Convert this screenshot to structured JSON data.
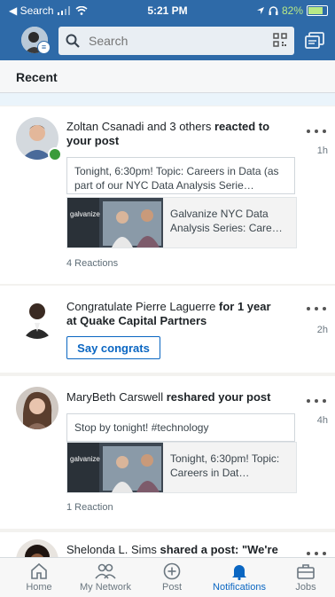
{
  "status_bar": {
    "back_label": "◀ Search",
    "time": "5:21 PM",
    "battery": "82%",
    "battery_level": 0.82
  },
  "header": {
    "search_placeholder": "Search"
  },
  "tabs": {
    "recent": "Recent"
  },
  "notifications": [
    {
      "name": "Zoltan Csanadi and 3 others",
      "action": " reacted to your post",
      "time": "1h",
      "quote": "Tonight, 6:30pm!  Topic: Careers in Data (as part of our NYC Data Analysis Serie…",
      "shared_title": "Galvanize NYC Data Analysis Series: Care…",
      "thumb_brand": "galvanize",
      "reactions": "4 Reactions"
    },
    {
      "name": "Congratulate Pierre Laguerre",
      "action": " for 1 year at Quake Capital Partners",
      "time": "2h",
      "button": "Say congrats"
    },
    {
      "name": "MaryBeth Carswell",
      "action": " reshared your post",
      "time": "4h",
      "quote": "Stop by tonight! #technology",
      "shared_title": "Tonight, 6:30pm! Topic: Careers in Dat…",
      "thumb_brand": "galvanize",
      "reactions": "1 Reaction"
    },
    {
      "name": "Shelonda L. Sims",
      "action": " shared a post: \"We're"
    }
  ],
  "bottom_nav": {
    "home": "Home",
    "network": "My Network",
    "post": "Post",
    "notifications": "Notifications",
    "jobs": "Jobs"
  },
  "colors": {
    "brand_blue": "#0a66c2",
    "topbar": "#2e6aa8",
    "online": "#3a9b3a"
  }
}
